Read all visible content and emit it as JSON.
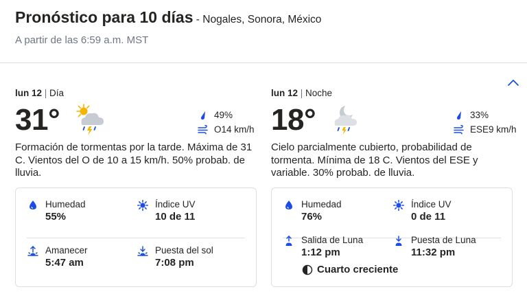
{
  "header": {
    "title": "Pronóstico para 10 días",
    "location": " - Nogales, Sonora, México",
    "subtitle": "A partir de las 6:59 a.m. MST"
  },
  "day": {
    "date": "lun 12",
    "separator": " | ",
    "period": "Día",
    "temperature": "31°",
    "icon": "scattered-thunderstorms-day-icon",
    "precip": "49%",
    "wind": "O14 km/h",
    "description": "Formación de tormentas por la tarde. Máxima de 31 C. Vientos del O de 10 a 15 km/h. 50% probab. de lluvia.",
    "details": {
      "humidity_label": "Humedad",
      "humidity_value": "55%",
      "uv_label": "Índice UV",
      "uv_value": "10 de 11",
      "rise_label": "Amanecer",
      "rise_value": "5:47 am",
      "set_label": "Puesta del sol",
      "set_value": "7:08 pm"
    }
  },
  "night": {
    "date": "lun 12",
    "separator": " | ",
    "period": "Noche",
    "temperature": "18°",
    "icon": "partly-cloudy-thunderstorm-night-icon",
    "precip": "33%",
    "wind": "ESE9 km/h",
    "description": "Cielo parcialmente cubierto, probabilidad de tormenta. Mínima de 18 C. Vientos del ESE y variable. 30% probab. de lluvia.",
    "details": {
      "humidity_label": "Humedad",
      "humidity_value": "76%",
      "uv_label": "Índice UV",
      "uv_value": "0 de 11",
      "rise_label": "Salida de Luna",
      "rise_value": "1:12 pm",
      "set_label": "Puesta de Luna",
      "set_value": "11:32 pm",
      "moon_phase": "Cuarto creciente"
    }
  },
  "colors": {
    "accent": "#1b4de4",
    "text": "#252422",
    "muted": "#6f7585",
    "border": "#dedede"
  }
}
